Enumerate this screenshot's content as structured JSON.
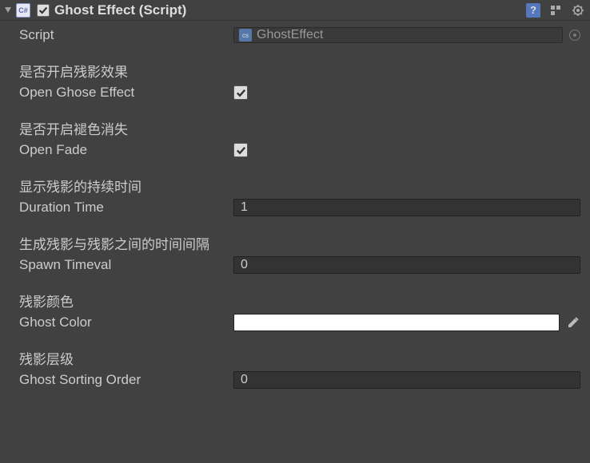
{
  "header": {
    "title": "Ghost Effect (Script)",
    "enabled": true
  },
  "script": {
    "label": "Script",
    "value": "GhostEffect"
  },
  "groups": [
    {
      "header": "是否开启残影效果",
      "label": "Open Ghose Effect",
      "type": "bool",
      "value": true
    },
    {
      "header": "是否开启褪色消失",
      "label": "Open Fade",
      "type": "bool",
      "value": true
    },
    {
      "header": "显示残影的持续时间",
      "label": "Duration Time",
      "type": "number",
      "value": "1"
    },
    {
      "header": "生成残影与残影之间的时间间隔",
      "label": "Spawn Timeval",
      "type": "number",
      "value": "0"
    },
    {
      "header": "残影颜色",
      "label": "Ghost Color",
      "type": "color",
      "value": "#ffffff"
    },
    {
      "header": "残影层级",
      "label": "Ghost Sorting Order",
      "type": "number",
      "value": "0"
    }
  ]
}
